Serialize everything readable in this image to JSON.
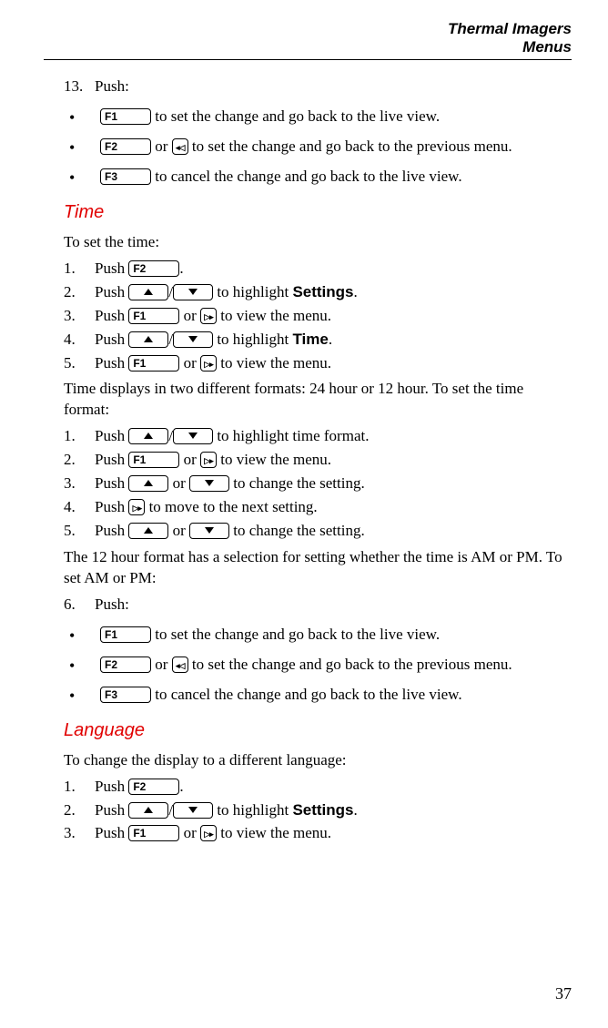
{
  "header": {
    "title": "Thermal Imagers",
    "subtitle": "Menus"
  },
  "keys": {
    "f1": "F1",
    "f2": "F2",
    "f3": "F3"
  },
  "step13": {
    "label": "Push:",
    "b1_after": " to set the change and go back to the live view.",
    "b2_mid": " or ",
    "b2_after": " to set the change and go back to the previous menu.",
    "b3_after": " to cancel the change and go back to the live view."
  },
  "time": {
    "heading": "Time",
    "intro": "To set the time:",
    "s1a": "Push ",
    "s1b": ".",
    "s2a": "Push ",
    "s2b": " to highlight ",
    "s2bold": "Settings",
    "s2c": ".",
    "s3a": "Push ",
    "s3mid": " or ",
    "s3b": " to view the menu.",
    "s4a": "Push ",
    "s4b": " to highlight ",
    "s4bold": "Time",
    "s4c": ".",
    "s5a": "Push ",
    "s5mid": " or ",
    "s5b": " to view the menu.",
    "para1": "Time displays in two different formats: 24 hour or 12 hour. To set the time format:",
    "t1a": "Push ",
    "t1b": " to highlight time format.",
    "t2a": "Push ",
    "t2mid": " or ",
    "t2b": " to view the menu.",
    "t3a": "Push ",
    "t3mid": " or ",
    "t3b": " to change the setting.",
    "t4a": "Push ",
    "t4b": " to move to the next setting.",
    "t5a": "Push ",
    "t5mid": " or ",
    "t5b": " to change the setting.",
    "para2": "The 12 hour format has a selection for setting whether the time is AM or PM. To set AM or PM:",
    "s6": "Push:",
    "b1_after": " to set the change and go back to the live view.",
    "b2_mid": " or ",
    "b2_after": " to set the change and go back to the previous menu.",
    "b3_after": " to cancel the change and go back to the live view."
  },
  "language": {
    "heading": "Language",
    "intro": "To change the display to a different language:",
    "s1a": "Push ",
    "s1b": ".",
    "s2a": "Push ",
    "s2b": " to highlight ",
    "s2bold": "Settings",
    "s2c": ".",
    "s3a": "Push ",
    "s3mid": " or ",
    "s3b": " to view the menu."
  },
  "page": "37"
}
